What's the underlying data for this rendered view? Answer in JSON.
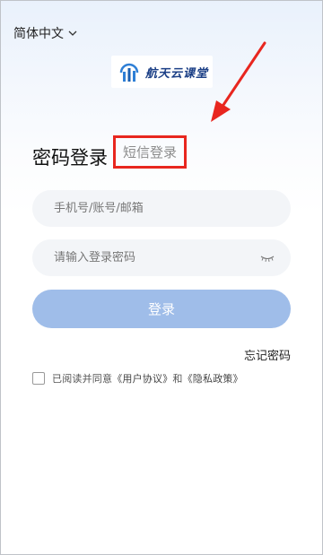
{
  "language": {
    "label": "简体中文"
  },
  "logo": {
    "text": "航天云课堂"
  },
  "tabs": {
    "password_login": "密码登录",
    "sms_login": "短信登录"
  },
  "form": {
    "account_placeholder": "手机号/账号/邮箱",
    "password_placeholder": "请输入登录密码",
    "login_button": "登录",
    "forgot_password": "忘记密码"
  },
  "agreement": {
    "prefix": "已阅读并同意",
    "user_agreement": "《用户协议》",
    "conjunction": "和",
    "privacy_policy": "《隐私政策》"
  },
  "colors": {
    "brand": "#1b3f86",
    "button": "#9fbde9",
    "annotation": "#e8261f"
  }
}
